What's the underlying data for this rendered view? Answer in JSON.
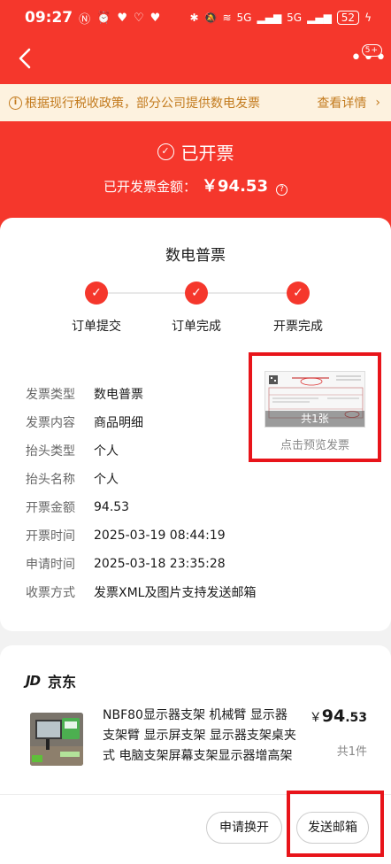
{
  "status_bar": {
    "time": "09:27",
    "left_icons": [
      "nfc-icon",
      "alarm-icon",
      "app-icon",
      "shield-icon",
      "app-icon"
    ],
    "network": "5G",
    "network2": "5G",
    "battery": "52"
  },
  "nav": {
    "more_badge": "5+"
  },
  "notice": {
    "text": "根据现行税收政策，部分公司提供数电发票",
    "link": "查看详情",
    "arrow": "›"
  },
  "invoice_status": {
    "title": "已开票",
    "amount_label": "已开发票金额：",
    "amount": "￥94.53",
    "help_icon": "?"
  },
  "invoice_card": {
    "title": "数电普票",
    "steps": [
      {
        "label": "订单提交"
      },
      {
        "label": "订单完成"
      },
      {
        "label": "开票完成"
      }
    ],
    "rows": [
      {
        "key": "发票类型",
        "value": "数电普票"
      },
      {
        "key": "发票内容",
        "value": "商品明细"
      },
      {
        "key": "抬头类型",
        "value": "个人"
      },
      {
        "key": "抬头名称",
        "value": "个人"
      },
      {
        "key": "开票金额",
        "value": "94.53"
      },
      {
        "key": "开票时间",
        "value": "2025-03-19 08:44:19"
      },
      {
        "key": "申请时间",
        "value": "2025-03-18 23:35:28"
      },
      {
        "key": "收票方式",
        "value": "发票XML及图片支持发送邮箱"
      }
    ],
    "preview_count": "共1张",
    "preview_label": "点击预览发票"
  },
  "order": {
    "shop_logo": "JD",
    "shop_name": "京东",
    "product_title": "NBF80显示器支架 机械臂 显示器支架臂 显示屏支架 显示器支架桌夹式 电脑支架屏幕支架显示器增高架",
    "price_currency": "￥",
    "price_int": "94",
    "price_dec": ".53",
    "quantity": "共1件"
  },
  "actions": {
    "reissue": "申请换开",
    "send_email": "发送邮箱"
  },
  "colors": {
    "brand_red": "#f5372c",
    "notice_bg": "#fdf2df",
    "notice_text": "#c37b1e",
    "highlight_red": "#e8141a"
  }
}
